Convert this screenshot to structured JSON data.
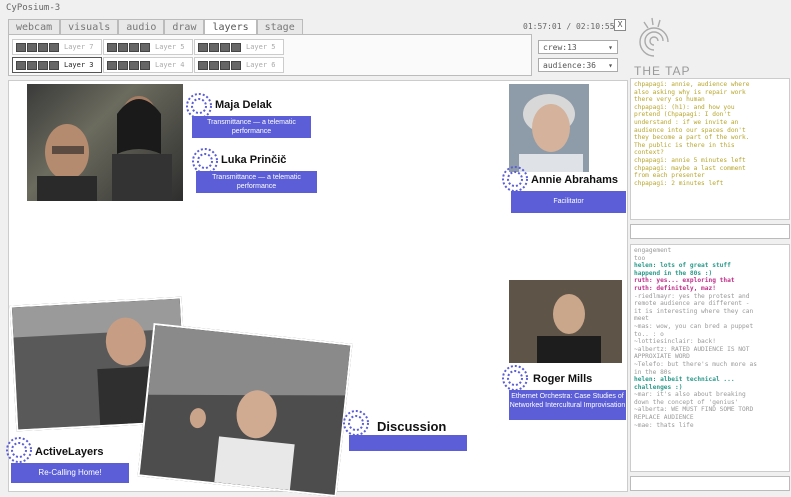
{
  "window": {
    "title": "CyPosium-3",
    "clock": "01:57:01 / 02:10:55",
    "close": "X"
  },
  "tabs": [
    {
      "label": "webcam",
      "active": false
    },
    {
      "label": "visuals",
      "active": false
    },
    {
      "label": "audio",
      "active": false
    },
    {
      "label": "draw",
      "active": false
    },
    {
      "label": "layers",
      "active": true
    },
    {
      "label": "stage",
      "active": false
    }
  ],
  "layers": [
    {
      "label": "Layer 7",
      "selected": false
    },
    {
      "label": "Layer 5",
      "selected": false
    },
    {
      "label": "Layer 5",
      "selected": false
    },
    {
      "label": "Layer 3",
      "selected": true
    },
    {
      "label": "Layer 4",
      "selected": false
    },
    {
      "label": "Layer 6",
      "selected": false
    }
  ],
  "dropdowns": {
    "crew": "crew:13",
    "audience": "audience:36"
  },
  "stage": {
    "participants": [
      {
        "name": "Maja Delak",
        "subtitle": "Transmittance — a telematic performance"
      },
      {
        "name": "Luka Prinčič",
        "subtitle": "Transmittance — a telematic performance"
      },
      {
        "name": "Annie Abrahams",
        "subtitle": "Facilitator"
      },
      {
        "name": "Roger Mills",
        "subtitle": "Ethernet Orchestra: Case Studies of Networked Intercultural Improvisation"
      },
      {
        "name": "ActiveLayers",
        "subtitle": "Re-Calling Home!"
      },
      {
        "name": "Discussion",
        "subtitle": ""
      }
    ]
  },
  "brand": {
    "name": "THE TAP"
  },
  "chat": [
    "chpapagi: annie, audience where",
    "also asking why is repair work",
    "there very so human",
    "chpapagi: (h1): and how you",
    "pretend (Chpapagi: I don't",
    "understand : if we invite an",
    "audience into our spaces don't",
    "they become a part of the work.",
    "The public is there in this",
    "context?",
    "chpapagi: annie 5 minutes left",
    "chpapagi: maybe a last comment",
    "from each presenter",
    "chpapagi: 2 minutes left"
  ],
  "feed": [
    {
      "text": "engagement",
      "style": ""
    },
    {
      "text": "too",
      "style": ""
    },
    {
      "text": "helen: lots of great stuff",
      "style": "c1"
    },
    {
      "text": "happend in the 80s :)",
      "style": "c1"
    },
    {
      "text": "ruth: yes... exploring that",
      "style": "c2"
    },
    {
      "text": "ruth: definitely, maz!",
      "style": "c2"
    },
    {
      "text": "-riedlmayr: yes the protest and",
      "style": ""
    },
    {
      "text": "remote audience are different -",
      "style": ""
    },
    {
      "text": "it is interesting where they can",
      "style": ""
    },
    {
      "text": "meet",
      "style": ""
    },
    {
      "text": "~mas: wow, you can bred a puppet",
      "style": ""
    },
    {
      "text": "to.. : o",
      "style": ""
    },
    {
      "text": "~lottiesinclair: back!",
      "style": ""
    },
    {
      "text": "~albertz: RATED AUDIENCE IS NOT",
      "style": ""
    },
    {
      "text": "APPROXIATE WORD",
      "style": ""
    },
    {
      "text": "~Telefo: but there's much more as",
      "style": ""
    },
    {
      "text": "in the 80s",
      "style": ""
    },
    {
      "text": "helen: albeit technical ...",
      "style": "c1"
    },
    {
      "text": "challenges :)",
      "style": "c1"
    },
    {
      "text": "~mar: it's also about breaking",
      "style": ""
    },
    {
      "text": "down the concept of 'genius'",
      "style": ""
    },
    {
      "text": "~alberta: WE MUST FIND SOME TORD",
      "style": ""
    },
    {
      "text": "REPLACE AUDIENCE",
      "style": ""
    },
    {
      "text": "~mae: thats life",
      "style": ""
    }
  ]
}
